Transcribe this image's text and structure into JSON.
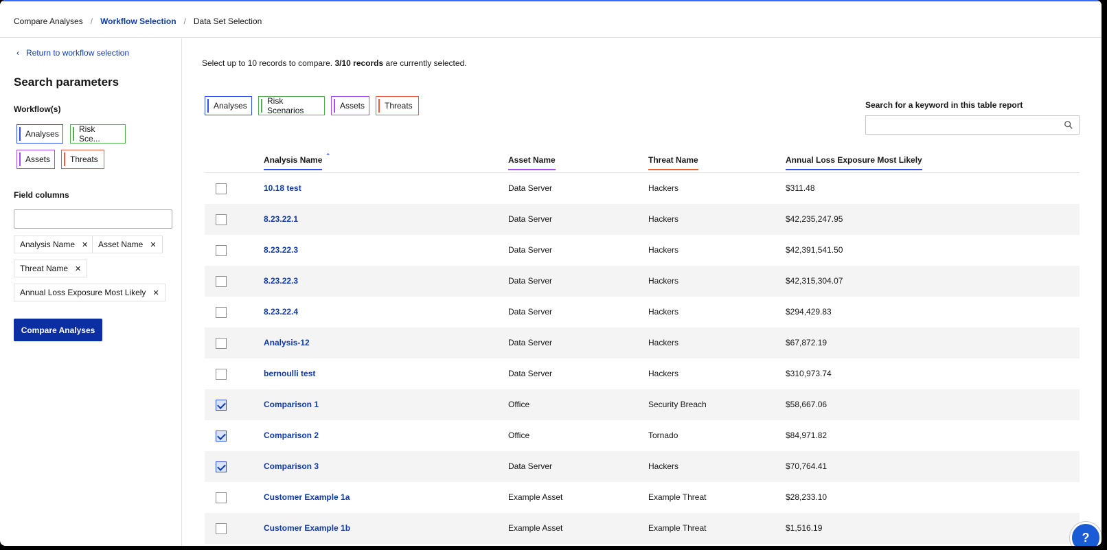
{
  "breadcrumb": {
    "items": [
      "Compare Analyses",
      "Workflow Selection",
      "Data Set Selection"
    ],
    "separator": "/"
  },
  "sidebar": {
    "back_link": "Return to workflow selection",
    "title": "Search parameters",
    "workflows_label": "Workflow(s)",
    "workflows": [
      "Analyses",
      "Risk Sce...",
      "Assets",
      "Threats"
    ],
    "field_columns_label": "Field columns",
    "field_columns_value": "",
    "chips": [
      "Analysis Name",
      "Asset Name",
      "Threat Name",
      "Annual Loss Exposure Most Likely"
    ],
    "compare_button": "Compare Analyses"
  },
  "main": {
    "intro_prefix": "Select up to 10 records to compare.",
    "intro_count": "3/10 records",
    "intro_suffix": "are currently selected.",
    "filter_tags": [
      "Analyses",
      "Risk Scenarios",
      "Assets",
      "Threats"
    ],
    "search_label": "Search for a keyword in this table report",
    "search_value": ""
  },
  "table": {
    "headers": [
      "Analysis Name",
      "Asset Name",
      "Threat Name",
      "Annual Loss Exposure Most Likely"
    ],
    "rows": [
      {
        "name": "10.18 test",
        "asset": "Data Server",
        "threat": "Hackers",
        "ale": "$311.48",
        "checked": false
      },
      {
        "name": "8.23.22.1",
        "asset": "Data Server",
        "threat": "Hackers",
        "ale": "$42,235,247.95",
        "checked": false
      },
      {
        "name": "8.23.22.3",
        "asset": "Data Server",
        "threat": "Hackers",
        "ale": "$42,391,541.50",
        "checked": false
      },
      {
        "name": "8.23.22.3",
        "asset": "Data Server",
        "threat": "Hackers",
        "ale": "$42,315,304.07",
        "checked": false
      },
      {
        "name": "8.23.22.4",
        "asset": "Data Server",
        "threat": "Hackers",
        "ale": "$294,429.83",
        "checked": false
      },
      {
        "name": "Analysis-12",
        "asset": "Data Server",
        "threat": "Hackers",
        "ale": "$67,872.19",
        "checked": false
      },
      {
        "name": "bernoulli test",
        "asset": "Data Server",
        "threat": "Hackers",
        "ale": "$310,973.74",
        "checked": false
      },
      {
        "name": "Comparison 1",
        "asset": "Office",
        "threat": "Security Breach",
        "ale": "$58,667.06",
        "checked": true
      },
      {
        "name": "Comparison 2",
        "asset": "Office",
        "threat": "Tornado",
        "ale": "$84,971.82",
        "checked": true
      },
      {
        "name": "Comparison 3",
        "asset": "Data Server",
        "threat": "Hackers",
        "ale": "$70,764.41",
        "checked": true
      },
      {
        "name": "Customer Example 1a",
        "asset": "Example Asset",
        "threat": "Example Threat",
        "ale": "$28,233.10",
        "checked": false
      },
      {
        "name": "Customer Example 1b",
        "asset": "Example Asset",
        "threat": "Example Threat",
        "ale": "$1,516.19",
        "checked": false
      }
    ]
  },
  "colors": {
    "primary": "#0b2ea3",
    "link": "#0f3aa8",
    "analyses": "#2f4fe8",
    "risk_scenarios": "#4fb04f",
    "assets": "#a84bf0",
    "threats": "#f05a3a"
  },
  "help_fab_icon": "help-chat-icon"
}
